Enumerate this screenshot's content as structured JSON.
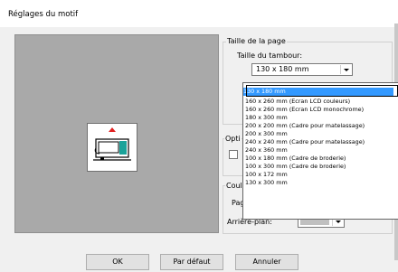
{
  "dialog": {
    "title": "Réglages du motif"
  },
  "page_size_group": {
    "label": "Taille de la page",
    "hoop_label": "Taille du tambour:",
    "hoop_value": "130 x 180 mm",
    "dropdown_items": [
      "130 x 180 mm",
      "160 x 260 mm (Ecran LCD couleurs)",
      "160 x 260 mm (Ecran LCD monochrome)",
      "180 x 300 mm",
      "200 x 200 mm (Cadre pour matelassage)",
      "200 x 300 mm",
      "240 x 240 mm (Cadre pour matelassage)",
      "240 x 360 mm",
      "100 x 180 mm (Cadre de broderie)",
      "100 x 300 mm (Cadre de broderie)",
      "100 x 172 mm",
      "130 x 300 mm"
    ],
    "selected_index": 0
  },
  "options_group": {
    "label": "Opti"
  },
  "color_group": {
    "label": "Coul",
    "page_label": "Page:",
    "background_label": "Arrière-plan:"
  },
  "buttons": {
    "ok": "OK",
    "default": "Par défaut",
    "cancel": "Annuler"
  },
  "colors": {
    "preview_bg": "#a9a9a9",
    "selection": "#3399ff",
    "machine_accent": "#1aa39a",
    "arrow_red": "#e02020"
  }
}
